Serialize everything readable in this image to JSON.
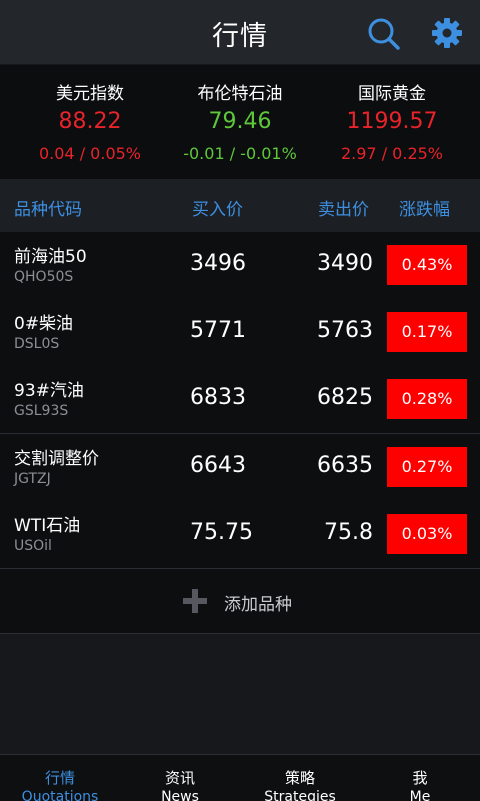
{
  "header": {
    "title": "行情",
    "search_icon": "search-icon",
    "settings_icon": "gear-icon",
    "accent_color": "#3d8fe0"
  },
  "indices": [
    {
      "name": "美元指数",
      "price": "88.22",
      "change": "0.04 / 0.05%",
      "direction": "up"
    },
    {
      "name": "布伦特石油",
      "price": "79.46",
      "change": "-0.01 / -0.01%",
      "direction": "down"
    },
    {
      "name": "国际黄金",
      "price": "1199.57",
      "change": "2.97 / 0.25%",
      "direction": "up"
    }
  ],
  "columns": {
    "product": "品种代码",
    "bid": "买入价",
    "ask": "卖出价",
    "change_pct": "涨跌幅"
  },
  "products": [
    {
      "name": "前海油50",
      "code": "QHO50S",
      "bid": "3496",
      "ask": "3490",
      "change_pct": "0.43%"
    },
    {
      "name": "0#柴油",
      "code": "DSL0S",
      "bid": "5771",
      "ask": "5763",
      "change_pct": "0.17%"
    },
    {
      "name": "93#汽油",
      "code": "GSL93S",
      "bid": "6833",
      "ask": "6825",
      "change_pct": "0.28%"
    },
    {
      "name": "交割调整价",
      "code": "JGTZJ",
      "bid": "6643",
      "ask": "6635",
      "change_pct": "0.27%"
    },
    {
      "name": "WTI石油",
      "code": "USOil",
      "bid": "75.75",
      "ask": "75.8",
      "change_pct": "0.03%"
    }
  ],
  "add_product": {
    "label": "添加品种",
    "icon": "plus-icon"
  },
  "colors": {
    "up": "#e8232a",
    "down": "#5ec83a",
    "badge_up": "#ff0000"
  },
  "tabs": [
    {
      "zh": "行情",
      "en": "Quotations",
      "active": true
    },
    {
      "zh": "资讯",
      "en": "News",
      "active": false
    },
    {
      "zh": "策略",
      "en": "Strategies",
      "active": false
    },
    {
      "zh": "我",
      "en": "Me",
      "active": false
    }
  ]
}
